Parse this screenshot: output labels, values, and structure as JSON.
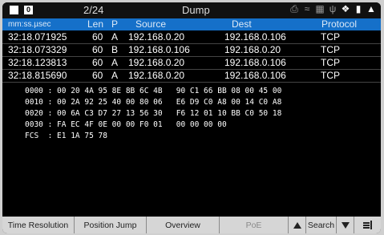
{
  "status": {
    "page": "2/24",
    "title": "Dump",
    "icons": [
      "printer-icon",
      "wifi-icon",
      "network-icon",
      "usb-icon",
      "tool-icon",
      "sd-card-icon",
      "battery-icon"
    ]
  },
  "table": {
    "headers": {
      "time": "mm:ss.µsec",
      "len": "Len",
      "p": "P",
      "source": "Source",
      "dest": "Dest",
      "protocol": "Protocol"
    },
    "rows": [
      {
        "time": "32:18.071925",
        "len": "60",
        "p": "A",
        "source": "192.168.0.20",
        "dest": "192.168.0.106",
        "protocol": "TCP"
      },
      {
        "time": "32:18.073329",
        "len": "60",
        "p": "B",
        "source": "192.168.0.106",
        "dest": "192.168.0.20",
        "protocol": "TCP"
      },
      {
        "time": "32:18.123813",
        "len": "60",
        "p": "A",
        "source": "192.168.0.20",
        "dest": "192.168.0.106",
        "protocol": "TCP"
      },
      {
        "time": "32:18.815690",
        "len": "60",
        "p": "A",
        "source": "192.168.0.20",
        "dest": "192.168.0.106",
        "protocol": "TCP"
      }
    ]
  },
  "hex_dump": [
    "0000 : 00 20 4A 95 8E 8B 6C 4B   90 C1 66 BB 08 00 45 00",
    "0010 : 00 2A 92 25 40 00 80 06   E6 D9 C0 A8 00 14 C0 A8",
    "0020 : 00 6A C3 D7 27 13 56 30   F6 12 01 10 BB C0 50 18",
    "0030 : FA EC 4F 0E 00 00 F0 01   00 00 00 00",
    "FCS  : E1 1A 75 78"
  ],
  "toolbar": {
    "time_resolution": "Time Resolution",
    "position_jump": "Position Jump",
    "overview": "Overview",
    "poe": "PoE",
    "search": "Search"
  }
}
